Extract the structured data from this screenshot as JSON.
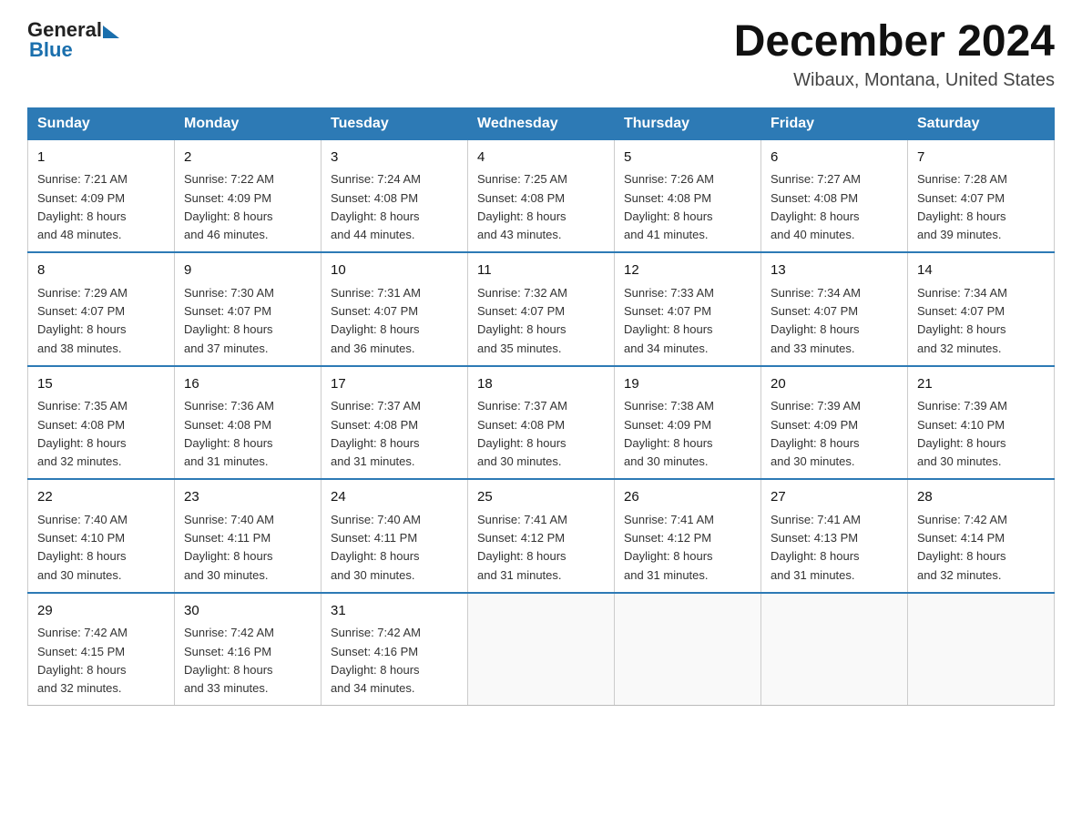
{
  "logo": {
    "general": "General",
    "blue": "Blue"
  },
  "title": {
    "month": "December 2024",
    "location": "Wibaux, Montana, United States"
  },
  "weekdays": [
    "Sunday",
    "Monday",
    "Tuesday",
    "Wednesday",
    "Thursday",
    "Friday",
    "Saturday"
  ],
  "weeks": [
    [
      {
        "day": 1,
        "sunrise": "7:21 AM",
        "sunset": "4:09 PM",
        "daylight": "8 hours and 48 minutes."
      },
      {
        "day": 2,
        "sunrise": "7:22 AM",
        "sunset": "4:09 PM",
        "daylight": "8 hours and 46 minutes."
      },
      {
        "day": 3,
        "sunrise": "7:24 AM",
        "sunset": "4:08 PM",
        "daylight": "8 hours and 44 minutes."
      },
      {
        "day": 4,
        "sunrise": "7:25 AM",
        "sunset": "4:08 PM",
        "daylight": "8 hours and 43 minutes."
      },
      {
        "day": 5,
        "sunrise": "7:26 AM",
        "sunset": "4:08 PM",
        "daylight": "8 hours and 41 minutes."
      },
      {
        "day": 6,
        "sunrise": "7:27 AM",
        "sunset": "4:08 PM",
        "daylight": "8 hours and 40 minutes."
      },
      {
        "day": 7,
        "sunrise": "7:28 AM",
        "sunset": "4:07 PM",
        "daylight": "8 hours and 39 minutes."
      }
    ],
    [
      {
        "day": 8,
        "sunrise": "7:29 AM",
        "sunset": "4:07 PM",
        "daylight": "8 hours and 38 minutes."
      },
      {
        "day": 9,
        "sunrise": "7:30 AM",
        "sunset": "4:07 PM",
        "daylight": "8 hours and 37 minutes."
      },
      {
        "day": 10,
        "sunrise": "7:31 AM",
        "sunset": "4:07 PM",
        "daylight": "8 hours and 36 minutes."
      },
      {
        "day": 11,
        "sunrise": "7:32 AM",
        "sunset": "4:07 PM",
        "daylight": "8 hours and 35 minutes."
      },
      {
        "day": 12,
        "sunrise": "7:33 AM",
        "sunset": "4:07 PM",
        "daylight": "8 hours and 34 minutes."
      },
      {
        "day": 13,
        "sunrise": "7:34 AM",
        "sunset": "4:07 PM",
        "daylight": "8 hours and 33 minutes."
      },
      {
        "day": 14,
        "sunrise": "7:34 AM",
        "sunset": "4:07 PM",
        "daylight": "8 hours and 32 minutes."
      }
    ],
    [
      {
        "day": 15,
        "sunrise": "7:35 AM",
        "sunset": "4:08 PM",
        "daylight": "8 hours and 32 minutes."
      },
      {
        "day": 16,
        "sunrise": "7:36 AM",
        "sunset": "4:08 PM",
        "daylight": "8 hours and 31 minutes."
      },
      {
        "day": 17,
        "sunrise": "7:37 AM",
        "sunset": "4:08 PM",
        "daylight": "8 hours and 31 minutes."
      },
      {
        "day": 18,
        "sunrise": "7:37 AM",
        "sunset": "4:08 PM",
        "daylight": "8 hours and 30 minutes."
      },
      {
        "day": 19,
        "sunrise": "7:38 AM",
        "sunset": "4:09 PM",
        "daylight": "8 hours and 30 minutes."
      },
      {
        "day": 20,
        "sunrise": "7:39 AM",
        "sunset": "4:09 PM",
        "daylight": "8 hours and 30 minutes."
      },
      {
        "day": 21,
        "sunrise": "7:39 AM",
        "sunset": "4:10 PM",
        "daylight": "8 hours and 30 minutes."
      }
    ],
    [
      {
        "day": 22,
        "sunrise": "7:40 AM",
        "sunset": "4:10 PM",
        "daylight": "8 hours and 30 minutes."
      },
      {
        "day": 23,
        "sunrise": "7:40 AM",
        "sunset": "4:11 PM",
        "daylight": "8 hours and 30 minutes."
      },
      {
        "day": 24,
        "sunrise": "7:40 AM",
        "sunset": "4:11 PM",
        "daylight": "8 hours and 30 minutes."
      },
      {
        "day": 25,
        "sunrise": "7:41 AM",
        "sunset": "4:12 PM",
        "daylight": "8 hours and 31 minutes."
      },
      {
        "day": 26,
        "sunrise": "7:41 AM",
        "sunset": "4:12 PM",
        "daylight": "8 hours and 31 minutes."
      },
      {
        "day": 27,
        "sunrise": "7:41 AM",
        "sunset": "4:13 PM",
        "daylight": "8 hours and 31 minutes."
      },
      {
        "day": 28,
        "sunrise": "7:42 AM",
        "sunset": "4:14 PM",
        "daylight": "8 hours and 32 minutes."
      }
    ],
    [
      {
        "day": 29,
        "sunrise": "7:42 AM",
        "sunset": "4:15 PM",
        "daylight": "8 hours and 32 minutes."
      },
      {
        "day": 30,
        "sunrise": "7:42 AM",
        "sunset": "4:16 PM",
        "daylight": "8 hours and 33 minutes."
      },
      {
        "day": 31,
        "sunrise": "7:42 AM",
        "sunset": "4:16 PM",
        "daylight": "8 hours and 34 minutes."
      },
      null,
      null,
      null,
      null
    ]
  ]
}
